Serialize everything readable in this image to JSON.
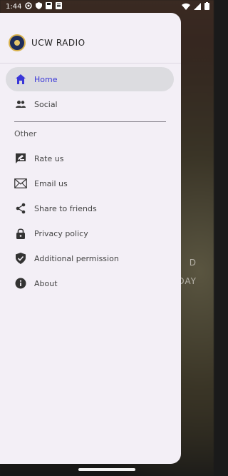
{
  "status_bar": {
    "time": "1:44"
  },
  "background": {
    "line1": "D",
    "line2": "DAY"
  },
  "drawer": {
    "title": "UCW RADIO",
    "items": [
      {
        "label": "Home",
        "icon": "home-icon"
      },
      {
        "label": "Social",
        "icon": "people-icon"
      }
    ],
    "section_label": "Other",
    "other_items": [
      {
        "label": "Rate us",
        "icon": "rate-icon"
      },
      {
        "label": "Email us",
        "icon": "mail-icon"
      },
      {
        "label": "Share to friends",
        "icon": "share-icon"
      },
      {
        "label": "Privacy policy",
        "icon": "lock-icon"
      },
      {
        "label": "Additional permission",
        "icon": "shield-check-icon"
      },
      {
        "label": "About",
        "icon": "info-icon"
      }
    ]
  },
  "colors": {
    "accent": "#3a37d8",
    "drawer_bg": "#f3eff6",
    "active_bg": "#dcdce0"
  }
}
